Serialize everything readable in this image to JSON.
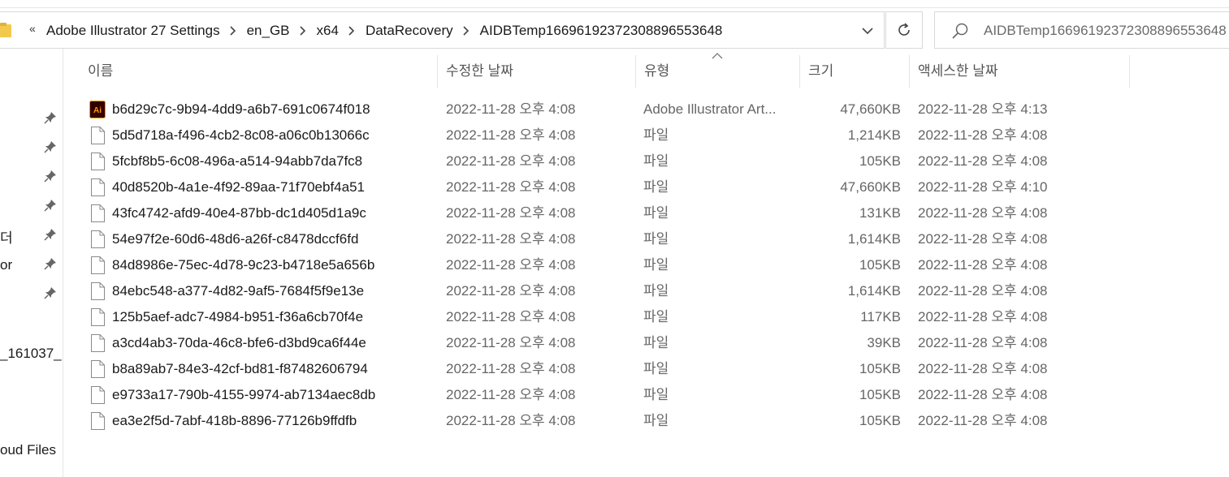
{
  "address": {
    "more_glyph": "«",
    "crumbs": [
      "Adobe Illustrator 27 Settings",
      "en_GB",
      "x64",
      "DataRecovery",
      "AIDBTemp16696192372308896553648"
    ]
  },
  "search": {
    "value": "AIDBTemp16696192372308896553648"
  },
  "nav_pane": {
    "items": [
      "더",
      "or",
      "_161037_",
      "oud Files"
    ]
  },
  "columns": {
    "name": "이름",
    "modified": "수정한 날짜",
    "type": "유형",
    "size": "크기",
    "accessed": "액세스한 날짜"
  },
  "files": [
    {
      "name": "b6d29c7c-9b94-4dd9-a6b7-691c0674f018",
      "modified": "2022-11-28 오후 4:08",
      "type": "Adobe Illustrator Art...",
      "size": "47,660KB",
      "accessed": "2022-11-28 오후 4:13",
      "icon": "illustrator-file-icon"
    },
    {
      "name": "5d5d718a-f496-4cb2-8c08-a06c0b13066c",
      "modified": "2022-11-28 오후 4:08",
      "type": "파일",
      "size": "1,214KB",
      "accessed": "2022-11-28 오후 4:08",
      "icon": "file-icon"
    },
    {
      "name": "5fcbf8b5-6c08-496a-a514-94abb7da7fc8",
      "modified": "2022-11-28 오후 4:08",
      "type": "파일",
      "size": "105KB",
      "accessed": "2022-11-28 오후 4:08",
      "icon": "file-icon"
    },
    {
      "name": "40d8520b-4a1e-4f92-89aa-71f70ebf4a51",
      "modified": "2022-11-28 오후 4:08",
      "type": "파일",
      "size": "47,660KB",
      "accessed": "2022-11-28 오후 4:10",
      "icon": "file-icon"
    },
    {
      "name": "43fc4742-afd9-40e4-87bb-dc1d405d1a9c",
      "modified": "2022-11-28 오후 4:08",
      "type": "파일",
      "size": "131KB",
      "accessed": "2022-11-28 오후 4:08",
      "icon": "file-icon"
    },
    {
      "name": "54e97f2e-60d6-48d6-a26f-c8478dccf6fd",
      "modified": "2022-11-28 오후 4:08",
      "type": "파일",
      "size": "1,614KB",
      "accessed": "2022-11-28 오후 4:08",
      "icon": "file-icon"
    },
    {
      "name": "84d8986e-75ec-4d78-9c23-b4718e5a656b",
      "modified": "2022-11-28 오후 4:08",
      "type": "파일",
      "size": "105KB",
      "accessed": "2022-11-28 오후 4:08",
      "icon": "file-icon"
    },
    {
      "name": "84ebc548-a377-4d82-9af5-7684f5f9e13e",
      "modified": "2022-11-28 오후 4:08",
      "type": "파일",
      "size": "1,614KB",
      "accessed": "2022-11-28 오후 4:08",
      "icon": "file-icon"
    },
    {
      "name": "125b5aef-adc7-4984-b951-f36a6cb70f4e",
      "modified": "2022-11-28 오후 4:08",
      "type": "파일",
      "size": "117KB",
      "accessed": "2022-11-28 오후 4:08",
      "icon": "file-icon"
    },
    {
      "name": "a3cd4ab3-70da-46c8-bfe6-d3bd9ca6f44e",
      "modified": "2022-11-28 오후 4:08",
      "type": "파일",
      "size": "39KB",
      "accessed": "2022-11-28 오후 4:08",
      "icon": "file-icon"
    },
    {
      "name": "b8a89ab7-84e3-42cf-bd81-f87482606794",
      "modified": "2022-11-28 오후 4:08",
      "type": "파일",
      "size": "105KB",
      "accessed": "2022-11-28 오후 4:08",
      "icon": "file-icon"
    },
    {
      "name": "e9733a17-790b-4155-9974-ab7134aec8db",
      "modified": "2022-11-28 오후 4:08",
      "type": "파일",
      "size": "105KB",
      "accessed": "2022-11-28 오후 4:08",
      "icon": "file-icon"
    },
    {
      "name": "ea3e2f5d-7abf-418b-8896-77126b9ffdfb",
      "modified": "2022-11-28 오후 4:08",
      "type": "파일",
      "size": "105KB",
      "accessed": "2022-11-28 오후 4:08",
      "icon": "file-icon"
    }
  ],
  "colors": {
    "illustrator_bg": "#330000",
    "illustrator_fg": "#ff9a00"
  }
}
